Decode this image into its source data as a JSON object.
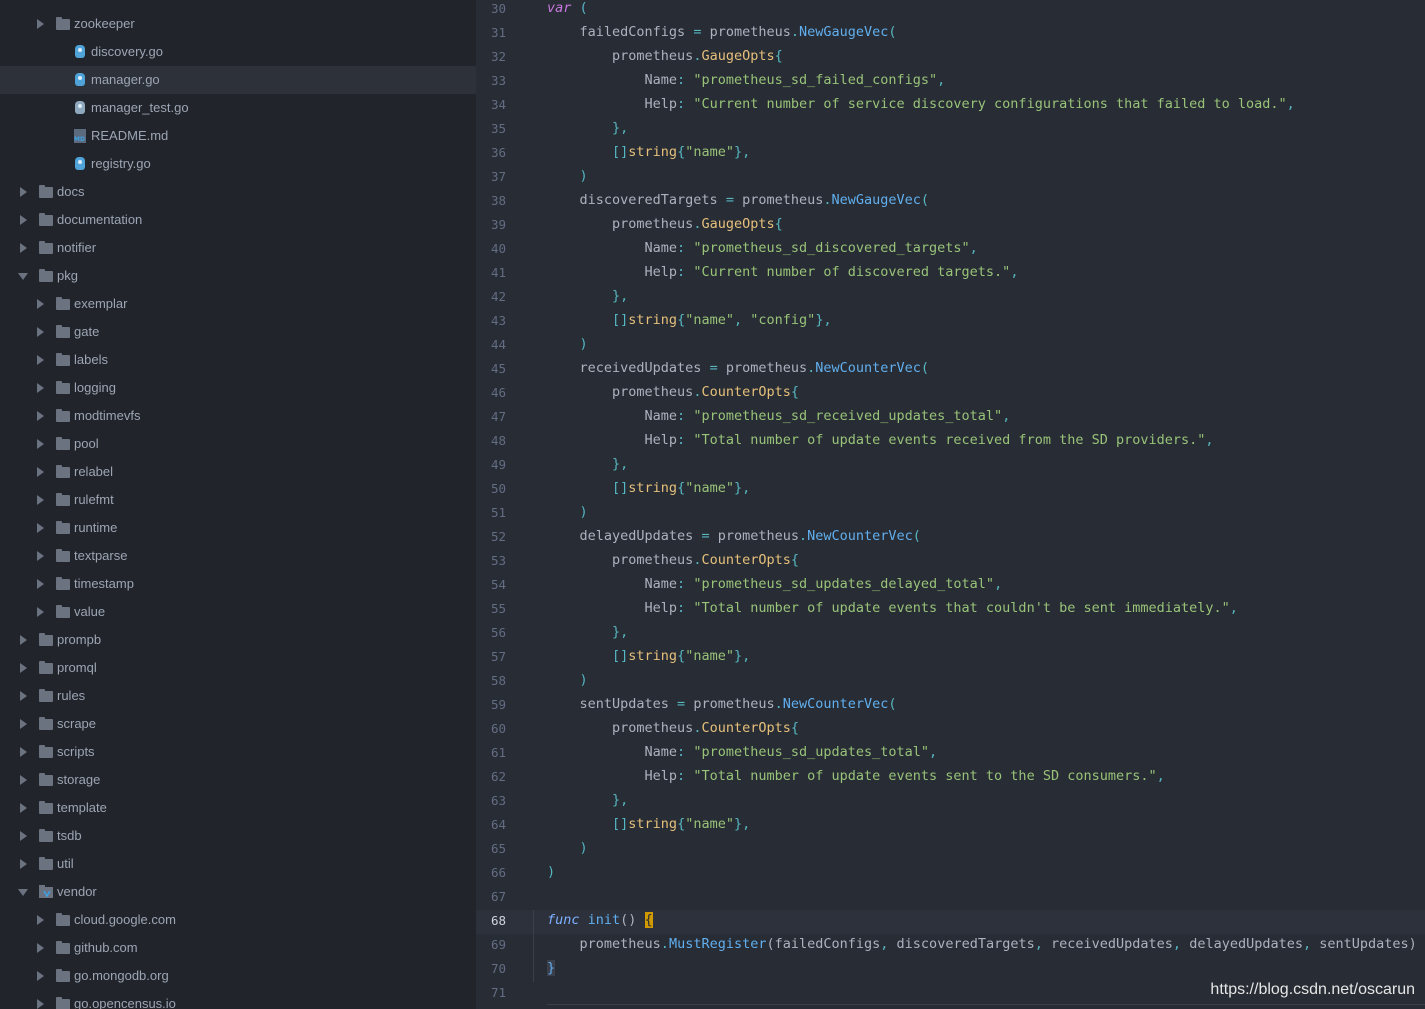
{
  "file_tree": {
    "items": [
      {
        "label": "zookeeper",
        "type": "folder",
        "depth": 1,
        "state": "collapsed"
      },
      {
        "label": "discovery.go",
        "type": "go",
        "depth": 2
      },
      {
        "label": "manager.go",
        "type": "go",
        "depth": 2,
        "selected": true
      },
      {
        "label": "manager_test.go",
        "type": "test-go",
        "depth": 2
      },
      {
        "label": "README.md",
        "type": "md",
        "depth": 2
      },
      {
        "label": "registry.go",
        "type": "go",
        "depth": 2
      },
      {
        "label": "docs",
        "type": "folder",
        "depth": 0,
        "state": "collapsed"
      },
      {
        "label": "documentation",
        "type": "folder",
        "depth": 0,
        "state": "collapsed"
      },
      {
        "label": "notifier",
        "type": "folder",
        "depth": 0,
        "state": "collapsed"
      },
      {
        "label": "pkg",
        "type": "folder",
        "depth": 0,
        "state": "expanded"
      },
      {
        "label": "exemplar",
        "type": "folder",
        "depth": 1,
        "state": "collapsed"
      },
      {
        "label": "gate",
        "type": "folder",
        "depth": 1,
        "state": "collapsed"
      },
      {
        "label": "labels",
        "type": "folder",
        "depth": 1,
        "state": "collapsed"
      },
      {
        "label": "logging",
        "type": "folder",
        "depth": 1,
        "state": "collapsed"
      },
      {
        "label": "modtimevfs",
        "type": "folder",
        "depth": 1,
        "state": "collapsed"
      },
      {
        "label": "pool",
        "type": "folder",
        "depth": 1,
        "state": "collapsed"
      },
      {
        "label": "relabel",
        "type": "folder",
        "depth": 1,
        "state": "collapsed"
      },
      {
        "label": "rulefmt",
        "type": "folder",
        "depth": 1,
        "state": "collapsed"
      },
      {
        "label": "runtime",
        "type": "folder",
        "depth": 1,
        "state": "collapsed"
      },
      {
        "label": "textparse",
        "type": "folder",
        "depth": 1,
        "state": "collapsed"
      },
      {
        "label": "timestamp",
        "type": "folder",
        "depth": 1,
        "state": "collapsed"
      },
      {
        "label": "value",
        "type": "folder",
        "depth": 1,
        "state": "collapsed"
      },
      {
        "label": "prompb",
        "type": "folder",
        "depth": 0,
        "state": "collapsed"
      },
      {
        "label": "promql",
        "type": "folder",
        "depth": 0,
        "state": "collapsed"
      },
      {
        "label": "rules",
        "type": "folder",
        "depth": 0,
        "state": "collapsed"
      },
      {
        "label": "scrape",
        "type": "folder",
        "depth": 0,
        "state": "collapsed"
      },
      {
        "label": "scripts",
        "type": "folder",
        "depth": 0,
        "state": "collapsed"
      },
      {
        "label": "storage",
        "type": "folder",
        "depth": 0,
        "state": "collapsed"
      },
      {
        "label": "template",
        "type": "folder",
        "depth": 0,
        "state": "collapsed"
      },
      {
        "label": "tsdb",
        "type": "folder",
        "depth": 0,
        "state": "collapsed"
      },
      {
        "label": "util",
        "type": "folder",
        "depth": 0,
        "state": "collapsed"
      },
      {
        "label": "vendor",
        "type": "vendor",
        "depth": 0,
        "state": "expanded"
      },
      {
        "label": "cloud.google.com",
        "type": "folder",
        "depth": 1,
        "state": "collapsed"
      },
      {
        "label": "github.com",
        "type": "folder",
        "depth": 1,
        "state": "collapsed"
      },
      {
        "label": "go.mongodb.org",
        "type": "folder",
        "depth": 1,
        "state": "collapsed"
      },
      {
        "label": "go.opencensus.io",
        "type": "folder",
        "depth": 1,
        "state": "collapsed"
      }
    ]
  },
  "editor": {
    "current_line": 68,
    "lines": [
      {
        "n": "30",
        "t": [
          [
            "kw",
            "var"
          ],
          [
            "plain",
            " "
          ],
          [
            "punc",
            "("
          ]
        ]
      },
      {
        "n": "31",
        "t": [
          [
            "plain",
            "    failedConfigs "
          ],
          [
            "punc",
            "="
          ],
          [
            "plain",
            " prometheus"
          ],
          [
            "punc",
            "."
          ],
          [
            "fn",
            "NewGaugeVec"
          ],
          [
            "punc",
            "("
          ]
        ]
      },
      {
        "n": "32",
        "t": [
          [
            "plain",
            "        prometheus"
          ],
          [
            "punc",
            "."
          ],
          [
            "typ",
            "GaugeOpts"
          ],
          [
            "punc",
            "{"
          ]
        ]
      },
      {
        "n": "33",
        "t": [
          [
            "plain",
            "            Name"
          ],
          [
            "punc",
            ":"
          ],
          [
            "plain",
            " "
          ],
          [
            "str",
            "\"prometheus_sd_failed_configs\""
          ],
          [
            "punc",
            ","
          ]
        ]
      },
      {
        "n": "34",
        "t": [
          [
            "plain",
            "            Help"
          ],
          [
            "punc",
            ":"
          ],
          [
            "plain",
            " "
          ],
          [
            "str",
            "\"Current number of service discovery configurations that failed to load.\""
          ],
          [
            "punc",
            ","
          ]
        ]
      },
      {
        "n": "35",
        "t": [
          [
            "plain",
            "        "
          ],
          [
            "punc",
            "},"
          ]
        ]
      },
      {
        "n": "36",
        "t": [
          [
            "plain",
            "        "
          ],
          [
            "punc",
            "[]"
          ],
          [
            "typ",
            "string"
          ],
          [
            "punc",
            "{"
          ],
          [
            "str",
            "\"name\""
          ],
          [
            "punc",
            "},"
          ]
        ]
      },
      {
        "n": "37",
        "t": [
          [
            "plain",
            "    "
          ],
          [
            "punc",
            ")"
          ]
        ]
      },
      {
        "n": "38",
        "t": [
          [
            "plain",
            "    discoveredTargets "
          ],
          [
            "punc",
            "="
          ],
          [
            "plain",
            " prometheus"
          ],
          [
            "punc",
            "."
          ],
          [
            "fn",
            "NewGaugeVec"
          ],
          [
            "punc",
            "("
          ]
        ]
      },
      {
        "n": "39",
        "t": [
          [
            "plain",
            "        prometheus"
          ],
          [
            "punc",
            "."
          ],
          [
            "typ",
            "GaugeOpts"
          ],
          [
            "punc",
            "{"
          ]
        ]
      },
      {
        "n": "40",
        "t": [
          [
            "plain",
            "            Name"
          ],
          [
            "punc",
            ":"
          ],
          [
            "plain",
            " "
          ],
          [
            "str",
            "\"prometheus_sd_discovered_targets\""
          ],
          [
            "punc",
            ","
          ]
        ]
      },
      {
        "n": "41",
        "t": [
          [
            "plain",
            "            Help"
          ],
          [
            "punc",
            ":"
          ],
          [
            "plain",
            " "
          ],
          [
            "str",
            "\"Current number of discovered targets.\""
          ],
          [
            "punc",
            ","
          ]
        ]
      },
      {
        "n": "42",
        "t": [
          [
            "plain",
            "        "
          ],
          [
            "punc",
            "},"
          ]
        ]
      },
      {
        "n": "43",
        "t": [
          [
            "plain",
            "        "
          ],
          [
            "punc",
            "[]"
          ],
          [
            "typ",
            "string"
          ],
          [
            "punc",
            "{"
          ],
          [
            "str",
            "\"name\""
          ],
          [
            "punc",
            ","
          ],
          [
            "plain",
            " "
          ],
          [
            "str",
            "\"config\""
          ],
          [
            "punc",
            "},"
          ]
        ]
      },
      {
        "n": "44",
        "t": [
          [
            "plain",
            "    "
          ],
          [
            "punc",
            ")"
          ]
        ]
      },
      {
        "n": "45",
        "t": [
          [
            "plain",
            "    receivedUpdates "
          ],
          [
            "punc",
            "="
          ],
          [
            "plain",
            " prometheus"
          ],
          [
            "punc",
            "."
          ],
          [
            "fn",
            "NewCounterVec"
          ],
          [
            "punc",
            "("
          ]
        ]
      },
      {
        "n": "46",
        "t": [
          [
            "plain",
            "        prometheus"
          ],
          [
            "punc",
            "."
          ],
          [
            "typ",
            "CounterOpts"
          ],
          [
            "punc",
            "{"
          ]
        ]
      },
      {
        "n": "47",
        "t": [
          [
            "plain",
            "            Name"
          ],
          [
            "punc",
            ":"
          ],
          [
            "plain",
            " "
          ],
          [
            "str",
            "\"prometheus_sd_received_updates_total\""
          ],
          [
            "punc",
            ","
          ]
        ]
      },
      {
        "n": "48",
        "t": [
          [
            "plain",
            "            Help"
          ],
          [
            "punc",
            ":"
          ],
          [
            "plain",
            " "
          ],
          [
            "str",
            "\"Total number of update events received from the SD providers.\""
          ],
          [
            "punc",
            ","
          ]
        ]
      },
      {
        "n": "49",
        "t": [
          [
            "plain",
            "        "
          ],
          [
            "punc",
            "},"
          ]
        ]
      },
      {
        "n": "50",
        "t": [
          [
            "plain",
            "        "
          ],
          [
            "punc",
            "[]"
          ],
          [
            "typ",
            "string"
          ],
          [
            "punc",
            "{"
          ],
          [
            "str",
            "\"name\""
          ],
          [
            "punc",
            "},"
          ]
        ]
      },
      {
        "n": "51",
        "t": [
          [
            "plain",
            "    "
          ],
          [
            "punc",
            ")"
          ]
        ]
      },
      {
        "n": "52",
        "t": [
          [
            "plain",
            "    delayedUpdates "
          ],
          [
            "punc",
            "="
          ],
          [
            "plain",
            " prometheus"
          ],
          [
            "punc",
            "."
          ],
          [
            "fn",
            "NewCounterVec"
          ],
          [
            "punc",
            "("
          ]
        ]
      },
      {
        "n": "53",
        "t": [
          [
            "plain",
            "        prometheus"
          ],
          [
            "punc",
            "."
          ],
          [
            "typ",
            "CounterOpts"
          ],
          [
            "punc",
            "{"
          ]
        ]
      },
      {
        "n": "54",
        "t": [
          [
            "plain",
            "            Name"
          ],
          [
            "punc",
            ":"
          ],
          [
            "plain",
            " "
          ],
          [
            "str",
            "\"prometheus_sd_updates_delayed_total\""
          ],
          [
            "punc",
            ","
          ]
        ]
      },
      {
        "n": "55",
        "t": [
          [
            "plain",
            "            Help"
          ],
          [
            "punc",
            ":"
          ],
          [
            "plain",
            " "
          ],
          [
            "str",
            "\"Total number of update events that couldn't be sent immediately.\""
          ],
          [
            "punc",
            ","
          ]
        ]
      },
      {
        "n": "56",
        "t": [
          [
            "plain",
            "        "
          ],
          [
            "punc",
            "},"
          ]
        ]
      },
      {
        "n": "57",
        "t": [
          [
            "plain",
            "        "
          ],
          [
            "punc",
            "[]"
          ],
          [
            "typ",
            "string"
          ],
          [
            "punc",
            "{"
          ],
          [
            "str",
            "\"name\""
          ],
          [
            "punc",
            "},"
          ]
        ]
      },
      {
        "n": "58",
        "t": [
          [
            "plain",
            "    "
          ],
          [
            "punc",
            ")"
          ]
        ]
      },
      {
        "n": "59",
        "t": [
          [
            "plain",
            "    sentUpdates "
          ],
          [
            "punc",
            "="
          ],
          [
            "plain",
            " prometheus"
          ],
          [
            "punc",
            "."
          ],
          [
            "fn",
            "NewCounterVec"
          ],
          [
            "punc",
            "("
          ]
        ]
      },
      {
        "n": "60",
        "t": [
          [
            "plain",
            "        prometheus"
          ],
          [
            "punc",
            "."
          ],
          [
            "typ",
            "CounterOpts"
          ],
          [
            "punc",
            "{"
          ]
        ]
      },
      {
        "n": "61",
        "t": [
          [
            "plain",
            "            Name"
          ],
          [
            "punc",
            ":"
          ],
          [
            "plain",
            " "
          ],
          [
            "str",
            "\"prometheus_sd_updates_total\""
          ],
          [
            "punc",
            ","
          ]
        ]
      },
      {
        "n": "62",
        "t": [
          [
            "plain",
            "            Help"
          ],
          [
            "punc",
            ":"
          ],
          [
            "plain",
            " "
          ],
          [
            "str",
            "\"Total number of update events sent to the SD consumers.\""
          ],
          [
            "punc",
            ","
          ]
        ]
      },
      {
        "n": "63",
        "t": [
          [
            "plain",
            "        "
          ],
          [
            "punc",
            "},"
          ]
        ]
      },
      {
        "n": "64",
        "t": [
          [
            "plain",
            "        "
          ],
          [
            "punc",
            "[]"
          ],
          [
            "typ",
            "string"
          ],
          [
            "punc",
            "{"
          ],
          [
            "str",
            "\"name\""
          ],
          [
            "punc",
            "},"
          ]
        ]
      },
      {
        "n": "65",
        "t": [
          [
            "plain",
            "    "
          ],
          [
            "punc",
            ")"
          ]
        ]
      },
      {
        "n": "66",
        "t": [
          [
            "punc",
            ")"
          ]
        ]
      },
      {
        "n": "67",
        "t": []
      },
      {
        "n": "68",
        "t": [
          [
            "kw2",
            "func"
          ],
          [
            "plain",
            " "
          ],
          [
            "fn",
            "init"
          ],
          [
            "plain",
            "() "
          ],
          [
            "brace-hl",
            "{"
          ]
        ]
      },
      {
        "n": "69",
        "t": [
          [
            "plain",
            "    prometheus"
          ],
          [
            "punc",
            "."
          ],
          [
            "fn",
            "MustRegister"
          ],
          [
            "plain",
            "(failedConfigs"
          ],
          [
            "punc",
            ","
          ],
          [
            "plain",
            " discoveredTargets"
          ],
          [
            "punc",
            ","
          ],
          [
            "plain",
            " receivedUpdates"
          ],
          [
            "punc",
            ","
          ],
          [
            "plain",
            " delayedUpdates"
          ],
          [
            "punc",
            ","
          ],
          [
            "plain",
            " sentUpdates)"
          ]
        ]
      },
      {
        "n": "70",
        "t": [
          [
            "brace-hl-soft",
            "}"
          ]
        ]
      },
      {
        "n": "71",
        "t": []
      }
    ]
  },
  "watermark": "https://blog.csdn.net/oscarun",
  "colors": {
    "tree_bg": "#21252b",
    "editor_bg": "#282c34",
    "selected_row": "#2c313a",
    "string": "#98c379",
    "function": "#61afef",
    "type": "#e5c07b",
    "keyword": "#c678dd",
    "match_brace": "#d19a00"
  }
}
